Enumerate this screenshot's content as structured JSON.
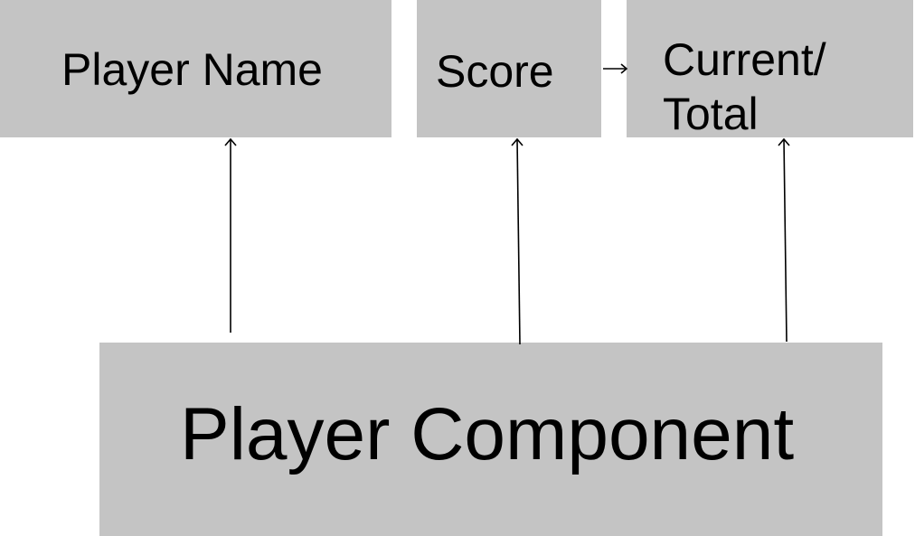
{
  "colors": {
    "box_fill": "#c4c4c4",
    "text": "#000000",
    "arrow": "#000000"
  },
  "nodes": {
    "player_name": {
      "label": "Player Name"
    },
    "score": {
      "label": "Score"
    },
    "current_total": {
      "label": "Current/\nTotal"
    },
    "player_component": {
      "label": "Player Component"
    }
  },
  "edges": [
    {
      "from": "player_component",
      "to": "player_name"
    },
    {
      "from": "player_component",
      "to": "score"
    },
    {
      "from": "player_component",
      "to": "current_total"
    },
    {
      "from": "score",
      "to": "current_total"
    }
  ]
}
